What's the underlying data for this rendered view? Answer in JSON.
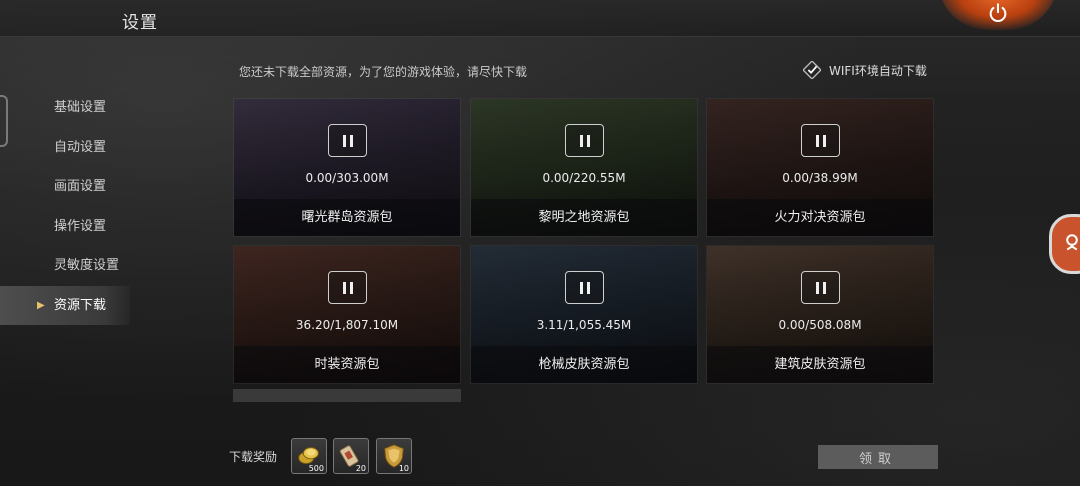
{
  "header": {
    "title": "设置"
  },
  "sidebar": {
    "items": [
      {
        "label": "基础设置"
      },
      {
        "label": "自动设置"
      },
      {
        "label": "画面设置"
      },
      {
        "label": "操作设置"
      },
      {
        "label": "灵敏度设置"
      },
      {
        "label": "资源下载",
        "active": true
      }
    ]
  },
  "download": {
    "notice": "您还未下载全部资源，为了您的游戏体验，请尽快下载",
    "wifi_label": "WIFI环境自动下载",
    "wifi_checked": true,
    "packs": [
      {
        "name": "曙光群岛资源包",
        "progress": "0.00/303.00M",
        "state": "paused"
      },
      {
        "name": "黎明之地资源包",
        "progress": "0.00/220.55M",
        "state": "paused"
      },
      {
        "name": "火力对决资源包",
        "progress": "0.00/38.99M",
        "state": "paused"
      },
      {
        "name": "时装资源包",
        "progress": "36.20/1,807.10M",
        "state": "paused"
      },
      {
        "name": "枪械皮肤资源包",
        "progress": "3.11/1,055.45M",
        "state": "paused"
      },
      {
        "name": "建筑皮肤资源包",
        "progress": "0.00/508.08M",
        "state": "paused"
      }
    ]
  },
  "rewards": {
    "label": "下载奖励",
    "items": [
      {
        "icon": "coins-icon",
        "qty": "500"
      },
      {
        "icon": "ticket-icon",
        "qty": "20"
      },
      {
        "icon": "badge-icon",
        "qty": "10"
      }
    ],
    "claim_label": "领取"
  },
  "colors": {
    "accent": "#e8c36a",
    "power": "#d9561f",
    "claim_disabled": "#5c5c5c"
  }
}
